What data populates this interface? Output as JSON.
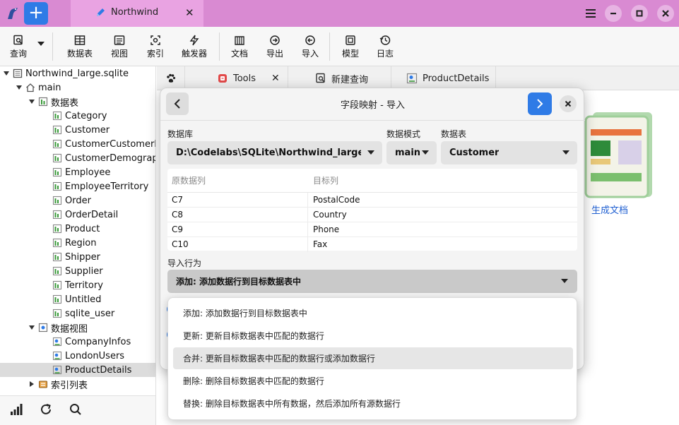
{
  "titlebar": {
    "tab_label": "Northwind",
    "tab_close": "✕",
    "new_tab": "+"
  },
  "toolbar": {
    "query": "查询",
    "table": "数据表",
    "view": "视图",
    "index": "索引",
    "trigger": "触发器",
    "document": "文档",
    "export": "导出",
    "import": "导入",
    "model": "模型",
    "log": "日志"
  },
  "tree": {
    "database": "Northwind_large.sqlite",
    "schema": "main",
    "tables_group": "数据表",
    "tables": [
      "Category",
      "Customer",
      "CustomerCustomerDemo",
      "CustomerDemographic",
      "Employee",
      "EmployeeTerritory",
      "Order",
      "OrderDetail",
      "Product",
      "Region",
      "Shipper",
      "Supplier",
      "Territory",
      "Untitled",
      "sqlite_user"
    ],
    "views_group": "数据视图",
    "views": [
      "CompanyInfos",
      "LondonUsers",
      "ProductDetails"
    ],
    "selected_view": "ProductDetails",
    "index_group": "索引列表"
  },
  "right_tabs": {
    "tools": "Tools",
    "tools_close": "✕",
    "new_query": "新建查询",
    "product_details": "ProductDetails"
  },
  "gen_doc": {
    "label": "生成文档"
  },
  "dialog": {
    "title": "字段映射 - 导入",
    "db_label": "数据库",
    "db_value": "D:\\Codelabs\\SQLite\\Northwind_large.sqlite",
    "schema_label": "数据模式",
    "schema_value": "main",
    "table_label": "数据表",
    "table_value": "Customer",
    "col_source": "原数据列",
    "col_target": "目标列",
    "rows": [
      {
        "source": "C7",
        "target": "PostalCode"
      },
      {
        "source": "C8",
        "target": "Country"
      },
      {
        "source": "C9",
        "target": "Phone"
      },
      {
        "source": "C10",
        "target": "Fax"
      }
    ],
    "import_label": "导入行为",
    "import_value": "添加: 添加数据行到目标数据表中"
  },
  "dropdown": {
    "options": [
      "添加: 添加数据行到目标数据表中",
      "更新: 更新目标数据表中匹配的数据行",
      "合并: 更新目标数据表中匹配的数据行或添加数据行",
      "删除: 删除目标数据表中匹配的数据行",
      "替换: 删除目标数据表中所有数据，然后添加所有源数据行"
    ],
    "highlighted_index": 2
  },
  "colors": {
    "titlebar": "#d98ad2",
    "accent": "#2f7be6",
    "link": "#1f5fd1"
  }
}
